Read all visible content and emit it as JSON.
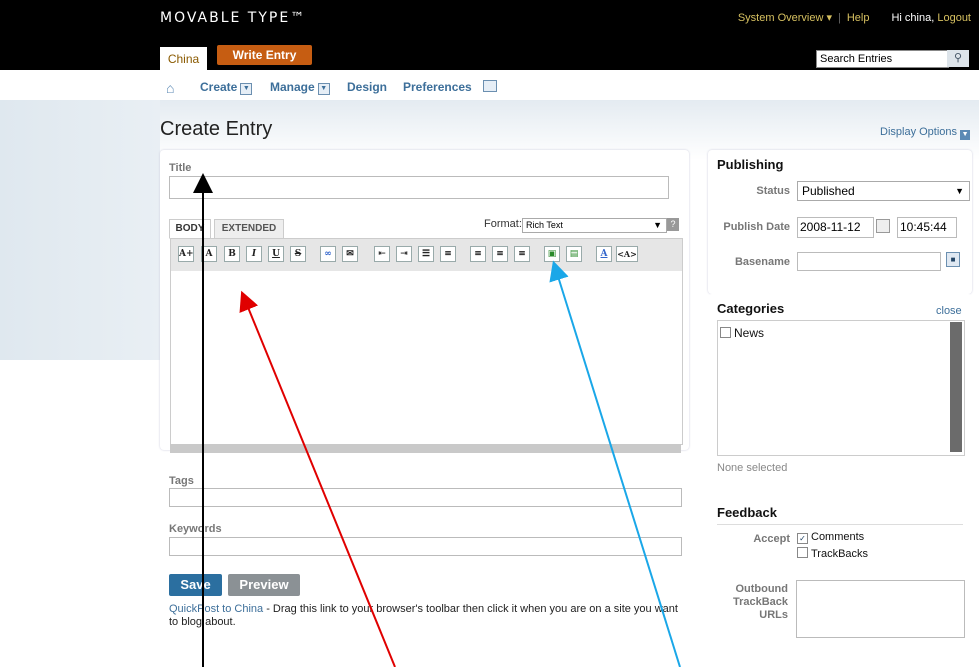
{
  "header": {
    "logo": "MOVABLE TYPE™",
    "system_overview": "System Overview ▾",
    "help": "Help",
    "greeting": "Hi china,",
    "logout": "Logout",
    "blog_tab": "China",
    "write_entry": "Write Entry",
    "search_placeholder": "Search Entries"
  },
  "menu": {
    "create": "Create",
    "manage": "Manage",
    "design": "Design",
    "preferences": "Preferences"
  },
  "page": {
    "title": "Create Entry",
    "display_options": "Display Options"
  },
  "form": {
    "title_label": "Title",
    "tab_body": "BODY",
    "tab_extended": "EXTENDED",
    "format_label": "Format:",
    "format_value": "Rich Text",
    "tags_label": "Tags",
    "keywords_label": "Keywords",
    "save": "Save",
    "preview": "Preview",
    "quickpost_link": "QuickPost to China",
    "quickpost_text": " - Drag this link to your browser's toolbar then click it when you are on a site you want to blog about."
  },
  "toolbar_icons": [
    "A+",
    "A",
    "B",
    "I",
    "U",
    "S",
    "∞",
    "✉",
    "⇤",
    "⇥",
    "☰",
    "≡",
    "≡",
    "≡",
    "≡",
    "▣",
    "▤",
    "A",
    "<A>"
  ],
  "publishing": {
    "heading": "Publishing",
    "status_label": "Status",
    "status_value": "Published",
    "date_label": "Publish Date",
    "date_value": "2008-11-12",
    "time_value": "10:45:44",
    "basename_label": "Basename"
  },
  "categories": {
    "heading": "Categories",
    "close": "close",
    "items": [
      "News"
    ],
    "none_selected": "None selected"
  },
  "feedback": {
    "heading": "Feedback",
    "accept_label": "Accept",
    "comments": "Comments",
    "trackbacks": "TrackBacks",
    "outbound_label_1": "Outbound",
    "outbound_label_2": "TrackBack",
    "outbound_label_3": "URLs"
  },
  "colors": {
    "accent": "#c65d12",
    "link": "#3d6f9a",
    "save_button": "#2b6fa0",
    "preview_button": "#8b9195"
  }
}
